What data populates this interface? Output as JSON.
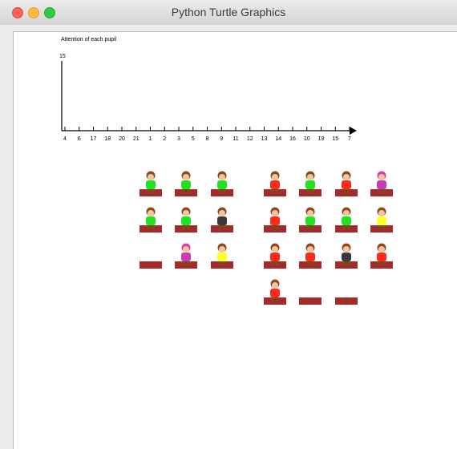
{
  "window": {
    "title": "Python Turtle Graphics"
  },
  "chart_data": {
    "type": "bar",
    "title": "Attention of each pupil",
    "ymax_label": "15",
    "categories": [
      "4",
      "6",
      "17",
      "18",
      "20",
      "21",
      "1",
      "2",
      "3",
      "5",
      "8",
      "9",
      "11",
      "12",
      "13",
      "14",
      "16",
      "10",
      "19",
      "15",
      "7"
    ],
    "values": [],
    "ylim": [
      0,
      15
    ]
  },
  "classroom": {
    "rows": [
      [
        "green",
        "green",
        "green",
        null,
        "red",
        "green",
        "red",
        "magenta"
      ],
      [
        "green",
        "green",
        "dark",
        null,
        "red",
        "green",
        "green",
        "yellow"
      ],
      [
        null,
        "magenta",
        "yellow",
        null,
        "red",
        "red",
        "dark",
        "red"
      ],
      [
        null,
        null,
        null,
        null,
        "red",
        null,
        null,
        null
      ]
    ],
    "desk_color": "#a52a2a",
    "shirt_colors": {
      "green": "#22e322",
      "red": "#ff2a1a",
      "magenta": "#c83cb4",
      "yellow": "#ffff2a",
      "dark": "#3a3a3a"
    }
  }
}
